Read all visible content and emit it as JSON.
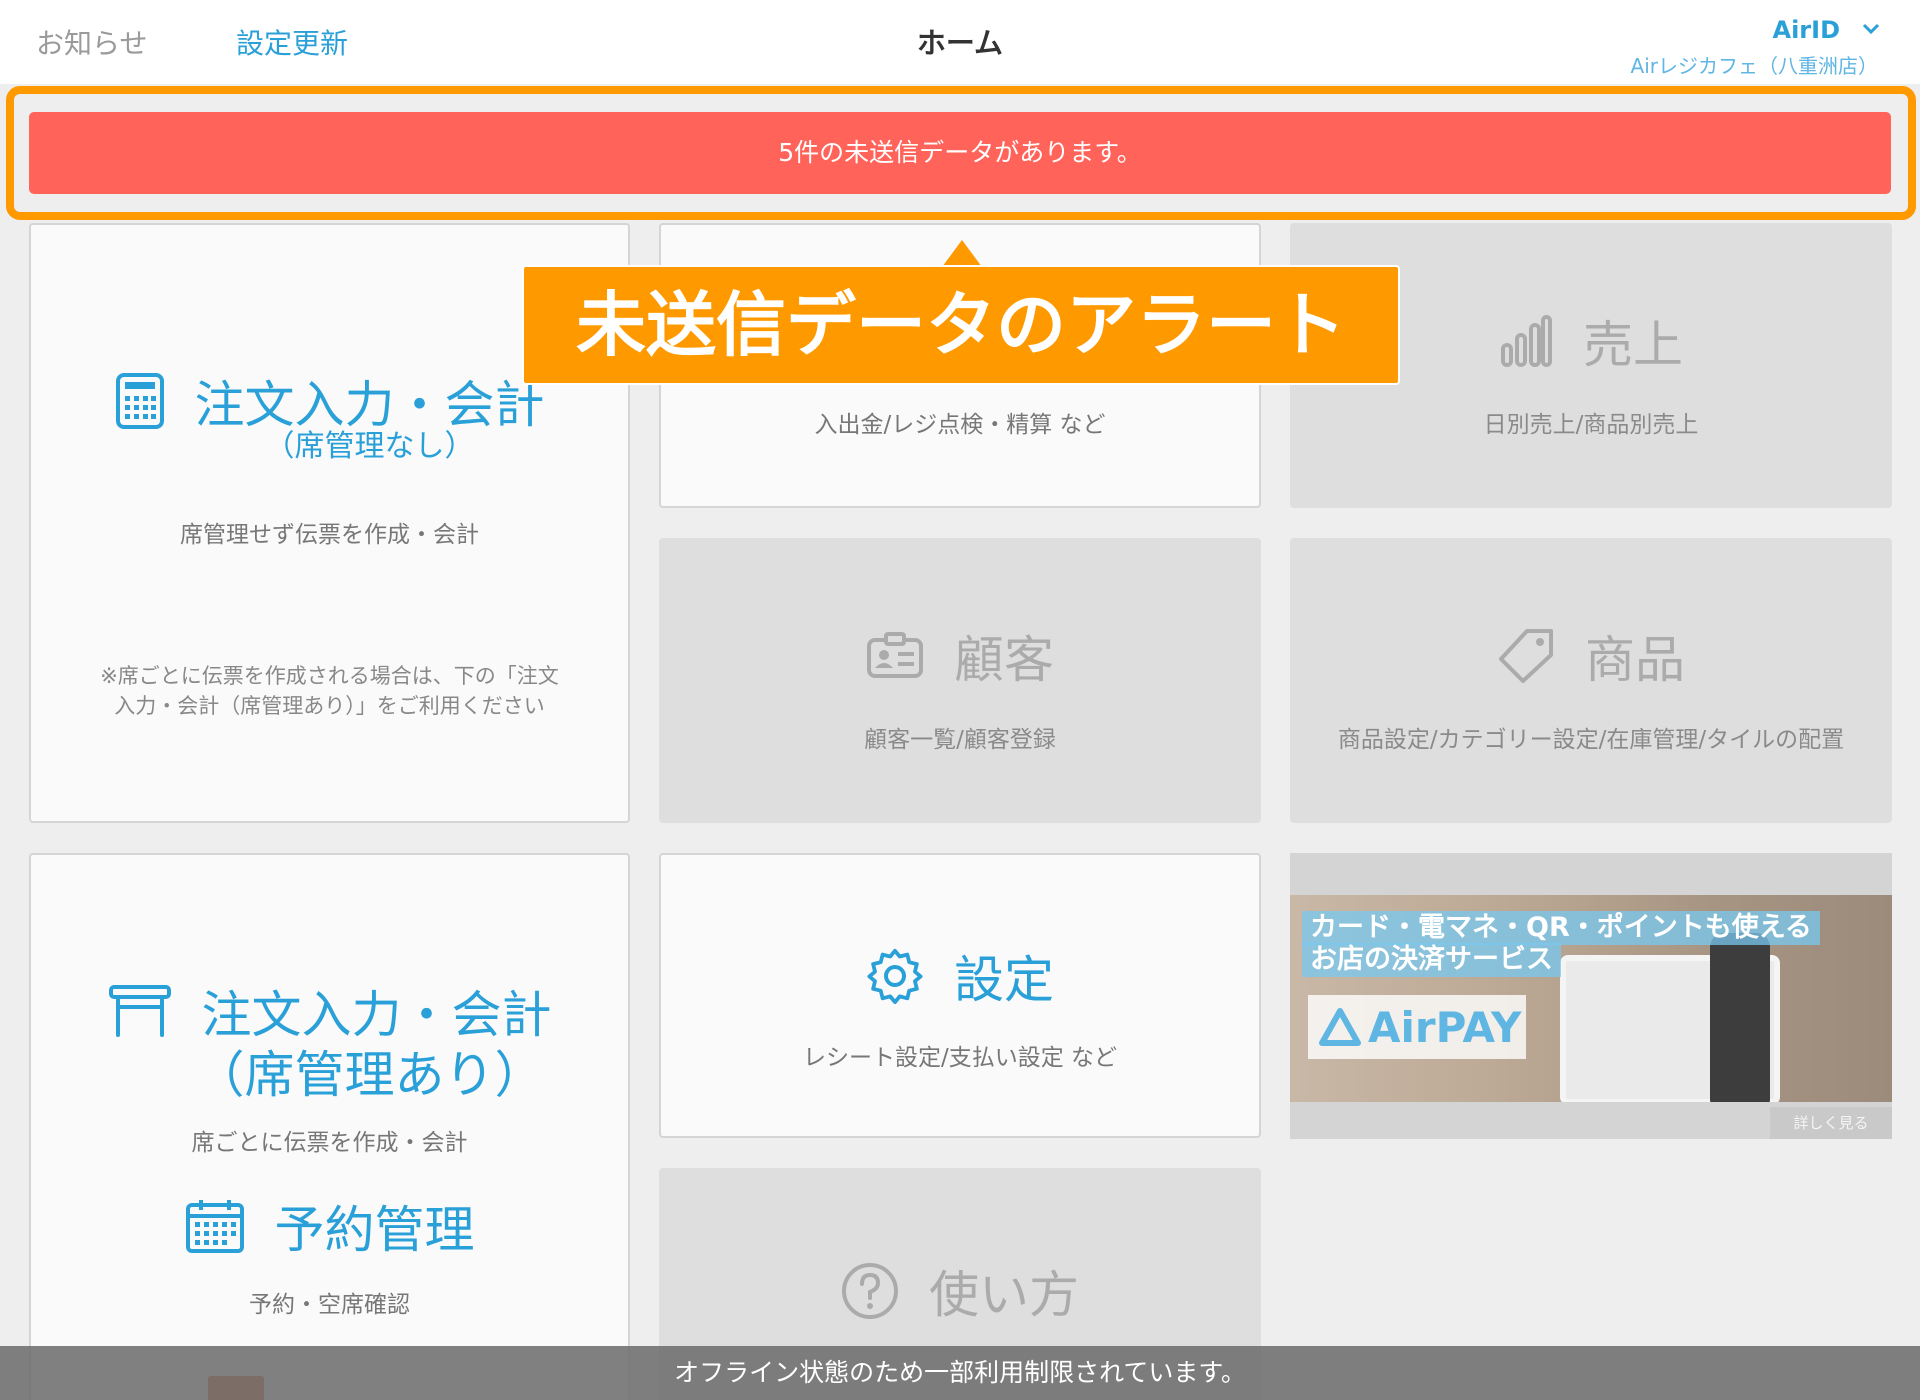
{
  "header": {
    "news": "お知らせ",
    "update": "設定更新",
    "title": "ホーム",
    "account": "AirID",
    "store": "Airレジカフェ（八重洲店）"
  },
  "alert": {
    "message": "5件の未送信データがあります。"
  },
  "callout": "未送信データのアラート",
  "tiles": {
    "order_noseat": {
      "title1": "注文入力・会計",
      "title2": "（席管理なし）",
      "desc": "席管理せず伝票を作成・会計",
      "note1": "※席ごとに伝票を作成される場合は、下の「注文",
      "note2": "入力・会計（席管理あり）」をご利用ください"
    },
    "cash": {
      "desc": "入出金/レジ点検・精算 など"
    },
    "sales": {
      "title": "売上",
      "desc": "日別売上/商品別売上"
    },
    "customer": {
      "title": "顧客",
      "desc": "顧客一覧/顧客登録"
    },
    "product": {
      "title": "商品",
      "desc": "商品設定/カテゴリー設定/在庫管理/タイルの配置"
    },
    "order_seat": {
      "title1": "注文入力・会計",
      "title2": "（席管理あり）",
      "desc": "席ごとに伝票を作成・会計"
    },
    "reservation": {
      "title": "予約管理",
      "desc": "予約・空席確認"
    },
    "settings": {
      "title": "設定",
      "desc": "レシート設定/支払い設定 など"
    },
    "howto": {
      "title": "使い方"
    }
  },
  "banner": {
    "line1": "カード・電マネ・QR・ポイントも使える",
    "line2": "お店の決済サービス",
    "logo": "AirPAY",
    "more": "詳しく見る"
  },
  "offline": "オフライン状態のため一部利用制限されています。",
  "colors": {
    "accent": "#2aa0d8",
    "alert": "#ff635a",
    "callout": "#ff9900"
  }
}
